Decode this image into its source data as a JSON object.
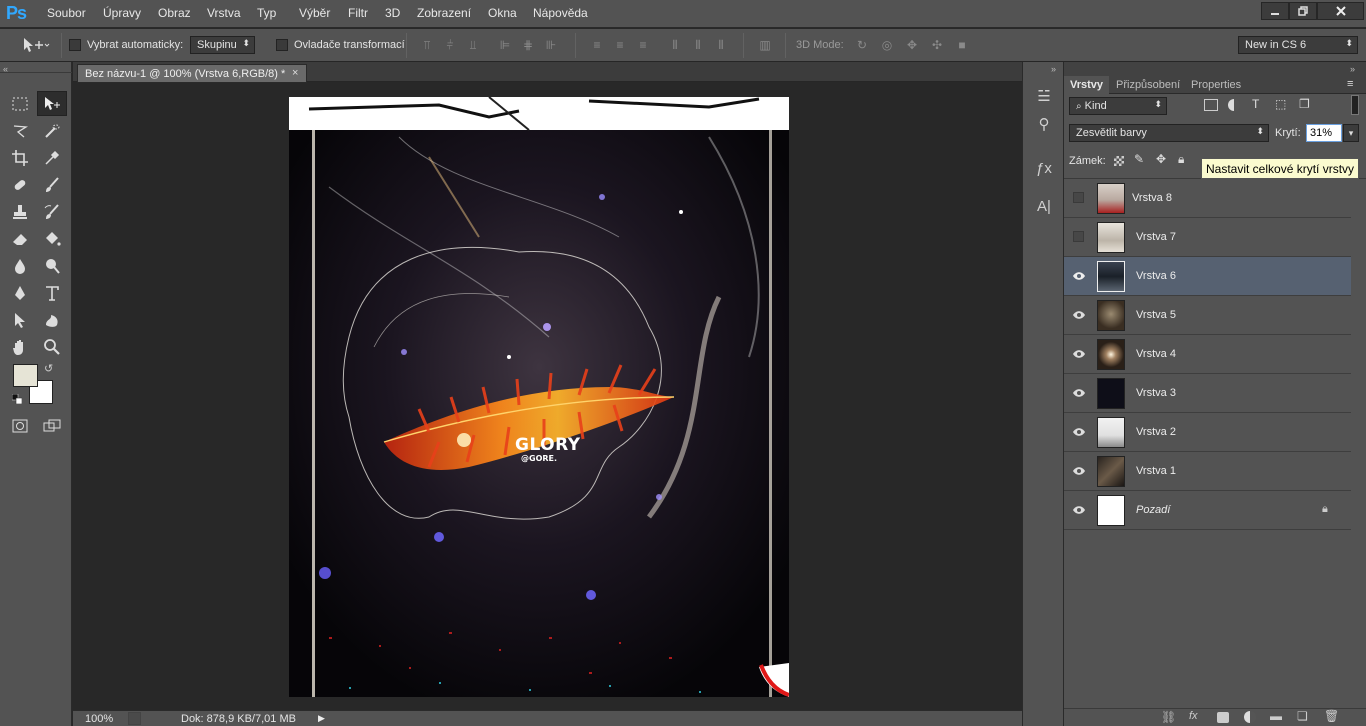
{
  "app": {
    "logo": "Ps",
    "accent": "#31a8ff"
  },
  "menu": [
    "Soubor",
    "Úpravy",
    "Obraz",
    "Vrstva",
    "Typ",
    "Výběr",
    "Filtr",
    "3D",
    "Zobrazení",
    "Okna",
    "Nápověda"
  ],
  "window_buttons": [
    "minimize-icon",
    "restore-icon",
    "close-icon"
  ],
  "options": {
    "auto_select_label": "Vybrat automaticky:",
    "auto_select_value": "Skupinu",
    "transform_label": "Ovladače transformací",
    "mode_label": "3D Mode:",
    "workspace_value": "New in CS 6"
  },
  "document": {
    "tab_title": "Bez názvu-1 @ 100% (Vrstva 6,RGB/8) *",
    "close_glyph": "×",
    "artwork_text": {
      "title": "GLORY",
      "subtitle": "@GORE."
    }
  },
  "status": {
    "zoom": "100%",
    "doc_info": "Dok: 878,9 KB/7,01 MB"
  },
  "layers_panel": {
    "tabs": [
      "Vrstvy",
      "Přizpůsobení",
      "Properties"
    ],
    "filter_value": "Kind",
    "blend_mode": "Zesvětlit barvy",
    "opacity_label": "Krytí:",
    "opacity_value": "31%",
    "lock_label": "Zámek:",
    "layers": [
      {
        "name": "Vrstva 8",
        "visible": false,
        "selected": false,
        "italic": false,
        "locked": false
      },
      {
        "name": "Vrstva 7",
        "visible": false,
        "selected": false,
        "italic": false,
        "locked": false
      },
      {
        "name": "Vrstva 6",
        "visible": true,
        "selected": true,
        "italic": false,
        "locked": false
      },
      {
        "name": "Vrstva 5",
        "visible": true,
        "selected": false,
        "italic": false,
        "locked": false
      },
      {
        "name": "Vrstva 4",
        "visible": true,
        "selected": false,
        "italic": false,
        "locked": false
      },
      {
        "name": "Vrstva 3",
        "visible": true,
        "selected": false,
        "italic": false,
        "locked": false
      },
      {
        "name": "Vrstva 2",
        "visible": true,
        "selected": false,
        "italic": false,
        "locked": false
      },
      {
        "name": "Vrstva 1",
        "visible": true,
        "selected": false,
        "italic": false,
        "locked": false
      },
      {
        "name": "Pozadí",
        "visible": true,
        "selected": false,
        "italic": true,
        "locked": true
      }
    ]
  },
  "tooltip": "Nastavit celkové krytí vrstvy",
  "colors": {
    "foreground": "#e6e4d6",
    "background": "#ffffff",
    "selected_layer": "#566171"
  }
}
